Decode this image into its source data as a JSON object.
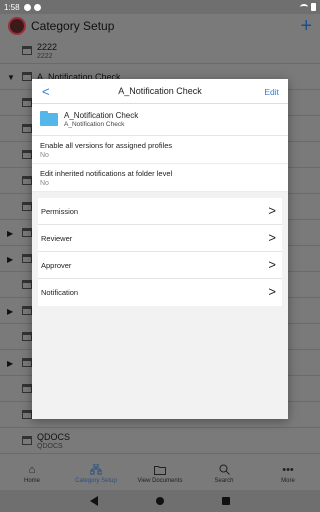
{
  "status_bar": {
    "time": "1:58"
  },
  "app_bar": {
    "title": "Category Setup",
    "add_label": "+"
  },
  "background_list": [
    {
      "name": "2222",
      "sub": "2222",
      "arrow": ""
    },
    {
      "name": "A_Notification Check",
      "sub": "",
      "arrow": "▼"
    },
    {
      "name": "",
      "sub": "",
      "arrow": ""
    },
    {
      "name": "",
      "sub": "",
      "arrow": ""
    },
    {
      "name": "",
      "sub": "",
      "arrow": ""
    },
    {
      "name": "",
      "sub": "",
      "arrow": ""
    },
    {
      "name": "",
      "sub": "",
      "arrow": ""
    },
    {
      "name": "",
      "sub": "",
      "arrow": "▶"
    },
    {
      "name": "",
      "sub": "",
      "arrow": "▶"
    },
    {
      "name": "",
      "sub": "",
      "arrow": ""
    },
    {
      "name": "",
      "sub": "",
      "arrow": "▶"
    },
    {
      "name": "",
      "sub": "",
      "arrow": ""
    },
    {
      "name": "",
      "sub": "",
      "arrow": "▶"
    },
    {
      "name": "",
      "sub": "",
      "arrow": ""
    },
    {
      "name": "",
      "sub": "",
      "arrow": ""
    },
    {
      "name": "QDOCS",
      "sub": "QDOCS",
      "arrow": ""
    }
  ],
  "modal": {
    "back_label": "<",
    "title": "A_Notification Check",
    "edit_label": "Edit",
    "folder": {
      "name": "A_Notification Check",
      "sub": "A_Notification Check"
    },
    "properties": [
      {
        "label": "Enable all versions for assigned profiles",
        "value": "No"
      },
      {
        "label": "Edit inherited notifications at folder level",
        "value": "No"
      }
    ],
    "nav_items": [
      {
        "label": "Permission"
      },
      {
        "label": "Reviewer"
      },
      {
        "label": "Approver"
      },
      {
        "label": "Notification"
      }
    ],
    "chevron": ">"
  },
  "bottom_nav": [
    {
      "label": "Home",
      "icon": "home-icon",
      "active": false
    },
    {
      "label": "Category Setup",
      "icon": "category-icon",
      "active": true
    },
    {
      "label": "View Documents",
      "icon": "folder-icon",
      "active": false
    },
    {
      "label": "Search",
      "icon": "search-icon",
      "active": false
    },
    {
      "label": "More",
      "icon": "more-icon",
      "active": false
    }
  ],
  "colors": {
    "accent": "#2f7ad6",
    "folder": "#55b6ea",
    "scrim": "#7a7a7a"
  }
}
